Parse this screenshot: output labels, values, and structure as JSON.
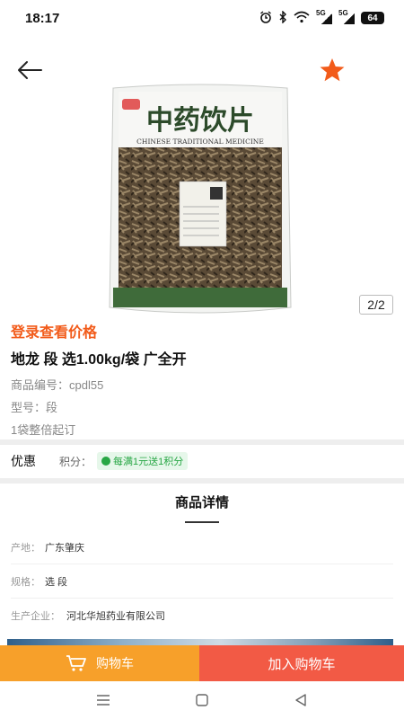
{
  "status_bar": {
    "time": "18:17",
    "network_1": "5G",
    "network_2": "5G",
    "battery": "64"
  },
  "header": {
    "back_icon": "arrow-left-icon",
    "favorite_icon": "star-icon",
    "favorite_color": "#f25b1a"
  },
  "gallery": {
    "page_indicator": "2/2",
    "package_title": "中药饮片",
    "package_subtitle": "CHINESE TRADITIONAL MEDICINE"
  },
  "product": {
    "login_price": "登录查看价格",
    "name": "地龙 段 选1.00kg/袋 广全开",
    "code": "商品编号：cpdl55",
    "model": "型号：段",
    "min_order": "1袋整倍起订"
  },
  "promo": {
    "label": "优惠",
    "points_label": "积分：",
    "points_badge": "每满1元送1积分"
  },
  "details": {
    "title": "商品详情",
    "rows": [
      {
        "label": "产地：",
        "value": "广东肇庆"
      },
      {
        "label": "规格：",
        "value": "选 段"
      },
      {
        "label": "生产企业：",
        "value": "河北华旭药业有限公司"
      }
    ]
  },
  "bottom_bar": {
    "cart_label": "购物车",
    "add_to_cart_label": "加入购物车",
    "cart_color": "#f7a02a",
    "add_color": "#f25a45"
  },
  "nav_bar": {
    "menu_icon": "menu-icon",
    "home_icon": "home-square-icon",
    "back_icon": "back-triangle-icon"
  }
}
